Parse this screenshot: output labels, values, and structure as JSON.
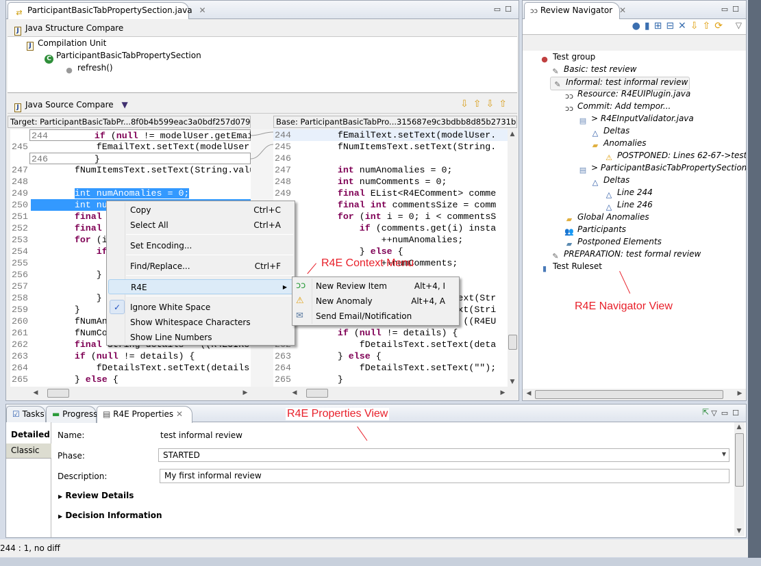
{
  "editor": {
    "tab_title": "ParticipantBasicTabPropertySection.java",
    "structure_compare": {
      "title": "Java Structure Compare",
      "tree": [
        "Compilation Unit",
        "ParticipantBasicTabPropertySection",
        "refresh()"
      ]
    },
    "source_compare": {
      "title": "Java Source Compare"
    },
    "target_header": "Target: ParticipantBasicTabPr...8f0b4b599eac3a0bdf257d079dae4",
    "base_header": "Base: ParticipantBasicTabPro...315687e9c3bdbb8d85b2731bb9ce",
    "left_lines": [
      {
        "n": "244",
        "t": "        if (null != modelUser.getEmail()"
      },
      {
        "n": "245",
        "t": "            fEmailText.setText(modelUser"
      },
      {
        "n": "246",
        "t": "        }"
      },
      {
        "n": "247",
        "t": "        fNumItemsText.setText(String.valu"
      },
      {
        "n": "248",
        "t": ""
      },
      {
        "n": "249",
        "t": "        int numAnomalies = 0;"
      },
      {
        "n": "250",
        "t": "        int nu"
      },
      {
        "n": "251",
        "t": "        final"
      },
      {
        "n": "252",
        "t": "        final"
      },
      {
        "n": "253",
        "t": "        for (i"
      },
      {
        "n": "254",
        "t": "            if"
      },
      {
        "n": "255",
        "t": ""
      },
      {
        "n": "256",
        "t": "            }"
      },
      {
        "n": "257",
        "t": ""
      },
      {
        "n": "258",
        "t": "            }"
      },
      {
        "n": "259",
        "t": "        }"
      },
      {
        "n": "260",
        "t": "        fNumAn"
      },
      {
        "n": "261",
        "t": "        fNumCo"
      },
      {
        "n": "262",
        "t": "        final String details = ((R4EUIRe"
      },
      {
        "n": "263",
        "t": "        if (null != details) {"
      },
      {
        "n": "264",
        "t": "            fDetailsText.setText(details)"
      },
      {
        "n": "265",
        "t": "        } else {"
      }
    ],
    "right_lines": [
      {
        "n": "244",
        "t": "        fEmailText.setText(modelUser."
      },
      {
        "n": "245",
        "t": "        fNumItemsText.setText(String."
      },
      {
        "n": "246",
        "t": ""
      },
      {
        "n": "247",
        "t": "        int numAnomalies = 0;"
      },
      {
        "n": "248",
        "t": "        int numComments = 0;"
      },
      {
        "n": "249",
        "t": "        final EList<R4EComment> comme"
      },
      {
        "n": "250",
        "t": "        final int commentsSize = comm"
      },
      {
        "n": "251",
        "t": "        for (int i = 0; i < commentsS"
      },
      {
        "n": "252",
        "t": "            if (comments.get(i) insta"
      },
      {
        "n": "253",
        "t": "                ++numAnomalies;"
      },
      {
        "n": "254",
        "t": "            } else {"
      },
      {
        "n": "255",
        "t": "                ++numComments;"
      },
      {
        "n": "256",
        "t": ""
      },
      {
        "n": "257",
        "t": ""
      },
      {
        "n": "258",
        "t": "        fNumAnomaliesText.setText(Str"
      },
      {
        "n": "259",
        "t": "        fNumCommentsText.setText(Stri"
      },
      {
        "n": "260",
        "t": "        final String details = ((R4EU"
      },
      {
        "n": "261",
        "t": "        if (null != details) {"
      },
      {
        "n": "262",
        "t": "            fDetailsText.setText(deta"
      },
      {
        "n": "263",
        "t": "        } else {"
      },
      {
        "n": "264",
        "t": "            fDetailsText.setText(\"\");"
      },
      {
        "n": "265",
        "t": "        }"
      }
    ]
  },
  "context_menu": {
    "items": [
      {
        "label": "Copy",
        "shortcut": "Ctrl+C"
      },
      {
        "label": "Select All",
        "shortcut": "Ctrl+A"
      },
      {
        "label": "Set Encoding...",
        "shortcut": ""
      },
      {
        "label": "Find/Replace...",
        "shortcut": "Ctrl+F"
      },
      {
        "label": "R4E",
        "shortcut": ""
      },
      {
        "label": "Ignore White Space",
        "shortcut": "",
        "checked": true
      },
      {
        "label": "Show Whitespace Characters",
        "shortcut": ""
      },
      {
        "label": "Show Line Numbers",
        "shortcut": ""
      }
    ],
    "submenu": [
      {
        "label": "New Review Item",
        "shortcut": "Alt+4, I",
        "icon": "new-review-item-icon"
      },
      {
        "label": "New Anomaly",
        "shortcut": "Alt+4, A",
        "icon": "new-anomaly-icon"
      },
      {
        "label": "Send Email/Notification",
        "shortcut": "",
        "icon": "envelope-icon"
      }
    ]
  },
  "navigator": {
    "tab_title": "Review Navigator",
    "tree": [
      {
        "label": "Test group",
        "italic": false
      },
      {
        "label": "Basic: test review"
      },
      {
        "label": "Informal: test informal review",
        "selected": true
      },
      {
        "label": "Resource: R4EUIPlugin.java"
      },
      {
        "label": "Commit: Add tempor..."
      },
      {
        "label": "> R4EInputValidator.java"
      },
      {
        "label": "Deltas"
      },
      {
        "label": "Anomalies"
      },
      {
        "label": "POSTPONED: Lines 62-67->test pos"
      },
      {
        "label": "> ParticipantBasicTabPropertySection.java"
      },
      {
        "label": "Deltas"
      },
      {
        "label": "Line 244"
      },
      {
        "label": "Line 246"
      },
      {
        "label": "Global Anomalies"
      },
      {
        "label": "Participants"
      },
      {
        "label": "Postponed Elements"
      },
      {
        "label": "PREPARATION: test formal review"
      },
      {
        "label": "Test Ruleset",
        "italic": false
      }
    ]
  },
  "bottom": {
    "tabs": [
      "Tasks",
      "Progress",
      "R4E Properties"
    ],
    "side_tabs": [
      "Detailed",
      "Classic"
    ],
    "name_label": "Name:",
    "name_value": "test informal review",
    "phase_label": "Phase:",
    "phase_value": "STARTED",
    "description_label": "Description:",
    "description_value": "My first informal review",
    "sections": [
      "Review Details",
      "Decision Information"
    ]
  },
  "status_bar": {
    "text": "244 : 1, no diff"
  },
  "annotations": {
    "context_menu": "R4E Context Menu",
    "navigator": "R4E Navigator View",
    "properties": "R4E Properties View"
  },
  "colors": {
    "keyword": "#7f0055",
    "selection": "#3399ff",
    "annotation": "#e8202a"
  }
}
